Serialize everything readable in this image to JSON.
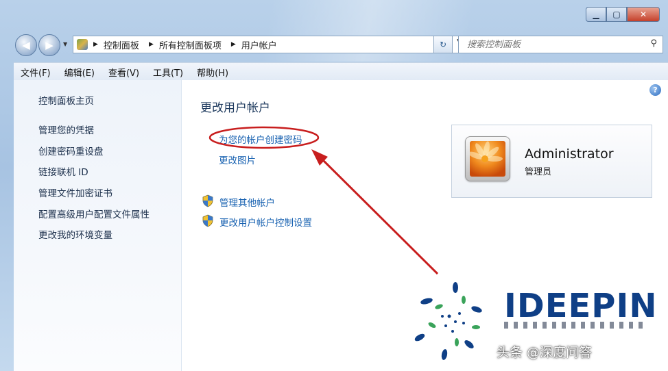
{
  "address_bar": {
    "breadcrumbs": [
      "控制面板",
      "所有控制面板项",
      "用户帐户"
    ],
    "search_placeholder": "搜索控制面板"
  },
  "menu": [
    "文件(F)",
    "编辑(E)",
    "查看(V)",
    "工具(T)",
    "帮助(H)"
  ],
  "sidebar": {
    "home": "控制面板主页",
    "items": [
      "管理您的凭据",
      "创建密码重设盘",
      "链接联机 ID",
      "管理文件加密证书",
      "配置高级用户配置文件属性",
      "更改我的环境变量"
    ]
  },
  "main": {
    "title": "更改用户帐户",
    "links": [
      "为您的帐户创建密码",
      "更改图片"
    ],
    "shield_links": [
      "管理其他帐户",
      "更改用户帐户控制设置"
    ]
  },
  "user": {
    "name": "Administrator",
    "role": "管理员"
  },
  "overlay": {
    "logo_text": "IDEEPIN",
    "watermark": "头条 @深度问答"
  },
  "colors": {
    "annotation": "#c81e1e",
    "link": "#1660b0",
    "logo": "#0f3f86"
  }
}
